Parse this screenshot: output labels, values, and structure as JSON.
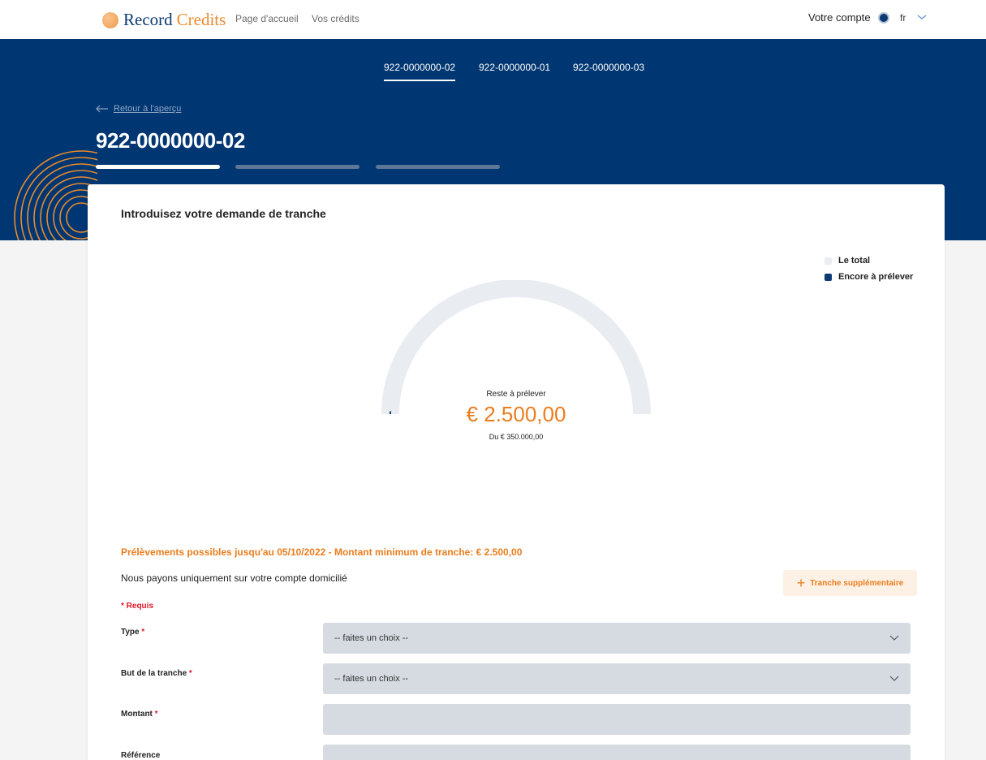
{
  "brand": {
    "part1": "Record",
    "part2": "Credits"
  },
  "nav": {
    "home": "Page d'accueil",
    "credits": "Vos crédits"
  },
  "account": {
    "label": "Votre compte",
    "lang": "fr"
  },
  "header": {
    "tabs": [
      {
        "label": "922-0000000-02",
        "active": true
      },
      {
        "label": "922-0000000-01",
        "active": false
      },
      {
        "label": "922-0000000-03",
        "active": false
      }
    ],
    "back_label": "Retour à l'aperçu",
    "title": "922-0000000-02"
  },
  "steps": {
    "count": 3,
    "current": 1
  },
  "card": {
    "title": "Introduisez votre demande de tranche"
  },
  "chart_data": {
    "type": "gauge",
    "total": 350000,
    "remaining": 2500,
    "legend": [
      {
        "label": "Le total",
        "color": "#e9ecf1"
      },
      {
        "label": "Encore à prélever",
        "color": "#0b3a74"
      }
    ],
    "center_label": "Reste à prélever",
    "value_label": "€ 2.500,00",
    "of_label": "Du € 350.000,00"
  },
  "form": {
    "notice": "Prélèvements possibles jusqu'au 05/10/2022 - Montant minimum de tranche: € 2.500,00",
    "pay_note": "Nous payons uniquement sur votre compte domicilié",
    "add_label": "Tranche supplémentaire",
    "required_label": "* Requis",
    "fields": [
      {
        "label": "Type",
        "required": true,
        "kind": "select",
        "value": "-- faites un choix --"
      },
      {
        "label": "But de la tranche",
        "required": true,
        "kind": "select",
        "value": "-- faites un choix --"
      },
      {
        "label": "Montant",
        "required": true,
        "kind": "input",
        "value": ""
      },
      {
        "label": "Référence",
        "required": false,
        "kind": "input",
        "value": ""
      }
    ]
  },
  "colors": {
    "navy": "#003672",
    "orange": "#ea7d1d",
    "field_bg": "#d6dbe2"
  }
}
